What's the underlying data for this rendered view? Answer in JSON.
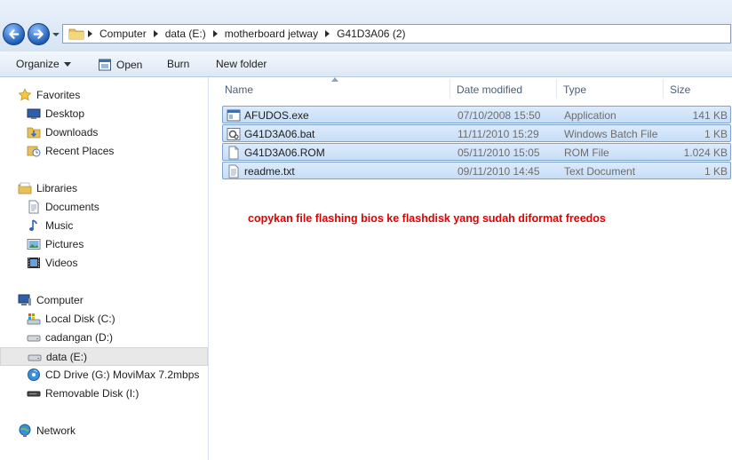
{
  "address": {
    "breadcrumbs": [
      "Computer",
      "data (E:)",
      "motherboard jetway",
      "G41D3A06 (2)"
    ]
  },
  "toolbar": {
    "organize_label": "Organize",
    "open_label": "Open",
    "burn_label": "Burn",
    "new_folder_label": "New folder"
  },
  "sidebar": {
    "favorites": {
      "label": "Favorites",
      "icon": "star-icon",
      "items": [
        {
          "label": "Desktop",
          "icon": "desktop-icon"
        },
        {
          "label": "Downloads",
          "icon": "downloads-icon"
        },
        {
          "label": "Recent Places",
          "icon": "recent-places-icon"
        }
      ]
    },
    "libraries": {
      "label": "Libraries",
      "icon": "libraries-icon",
      "items": [
        {
          "label": "Documents",
          "icon": "documents-icon"
        },
        {
          "label": "Music",
          "icon": "music-icon"
        },
        {
          "label": "Pictures",
          "icon": "pictures-icon"
        },
        {
          "label": "Videos",
          "icon": "videos-icon"
        }
      ]
    },
    "computer": {
      "label": "Computer",
      "icon": "computer-icon",
      "items": [
        {
          "label": "Local Disk (C:)",
          "icon": "local-disk-icon"
        },
        {
          "label": "cadangan (D:)",
          "icon": "drive-icon"
        },
        {
          "label": "data (E:)",
          "icon": "drive-icon",
          "selected": true
        },
        {
          "label": "CD Drive (G:) MoviMax 7.2mbps",
          "icon": "cd-drive-icon"
        },
        {
          "label": "Removable Disk (I:)",
          "icon": "removable-disk-icon"
        }
      ]
    },
    "network": {
      "label": "Network",
      "icon": "network-icon"
    }
  },
  "columns": {
    "name": "Name",
    "date": "Date modified",
    "type": "Type",
    "size": "Size"
  },
  "files": [
    {
      "name": "AFUDOS.exe",
      "date": "07/10/2008 15:50",
      "type": "Application",
      "size": "141 KB",
      "icon": "exe-icon"
    },
    {
      "name": "G41D3A06.bat",
      "date": "11/11/2010 15:29",
      "type": "Windows Batch File",
      "size": "1 KB",
      "icon": "batch-file-icon"
    },
    {
      "name": "G41D3A06.ROM",
      "date": "05/11/2010 15:05",
      "type": "ROM File",
      "size": "1.024 KB",
      "icon": "file-icon"
    },
    {
      "name": "readme.txt",
      "date": "09/11/2010 14:45",
      "type": "Text Document",
      "size": "1 KB",
      "icon": "text-file-icon"
    }
  ],
  "annotation": "copykan file flashing bios ke flashdisk yang sudah diformat freedos",
  "colors": {
    "annotation": "#e00000",
    "selection": "#cce0f8"
  }
}
